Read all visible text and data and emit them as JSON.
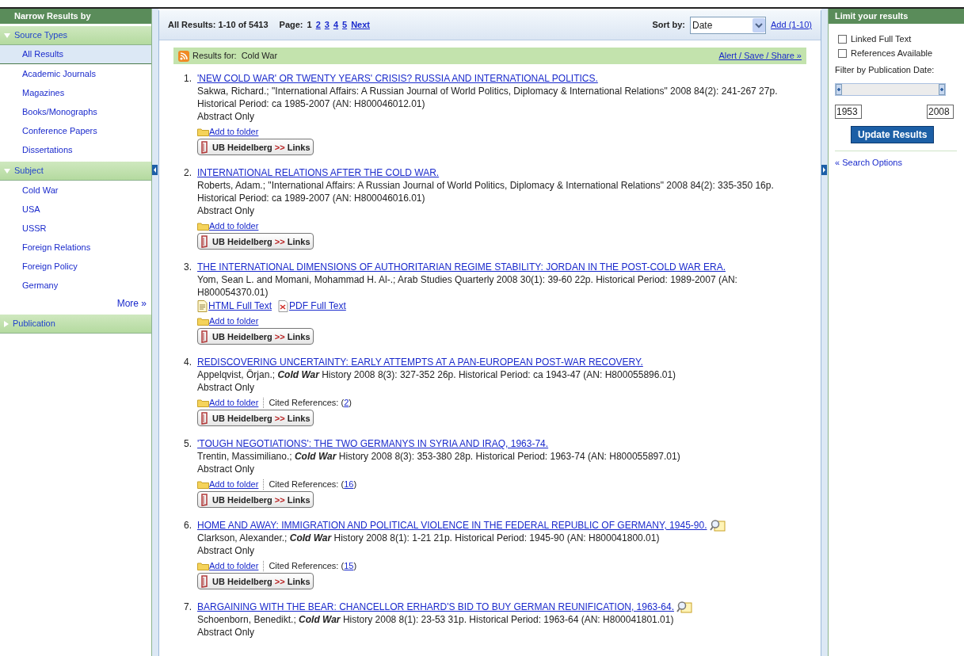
{
  "left_panel": {
    "title": "Narrow Results by",
    "sections": [
      {
        "label": "Source Types",
        "expanded": true,
        "items": [
          {
            "label": "All Results",
            "selected": true
          },
          {
            "label": "Academic Journals",
            "selected": false
          },
          {
            "label": "Magazines",
            "selected": false
          },
          {
            "label": "Books/Monographs",
            "selected": false
          },
          {
            "label": "Conference Papers",
            "selected": false
          },
          {
            "label": "Dissertations",
            "selected": false
          }
        ]
      },
      {
        "label": "Subject",
        "expanded": true,
        "items": [
          {
            "label": "Cold War",
            "selected": false
          },
          {
            "label": "USA",
            "selected": false
          },
          {
            "label": "USSR",
            "selected": false
          },
          {
            "label": "Foreign Relations",
            "selected": false
          },
          {
            "label": "Foreign Policy",
            "selected": false
          },
          {
            "label": "Germany",
            "selected": false
          }
        ],
        "more": "More »"
      },
      {
        "label": "Publication",
        "expanded": false
      }
    ]
  },
  "results_header": {
    "summary": "All Results: 1-10 of 5413",
    "page_label": "Page:",
    "pages": [
      {
        "label": "1",
        "selected": true
      },
      {
        "label": "2",
        "selected": false
      },
      {
        "label": "3",
        "selected": false
      },
      {
        "label": "4",
        "selected": false
      },
      {
        "label": "5",
        "selected": false
      }
    ],
    "next": "Next",
    "sort_label": "Sort by:",
    "sort_value": "Date",
    "add_link": "Add (1-10)"
  },
  "results_for": {
    "label": "Results for:",
    "query": "Cold War",
    "share_link": "Alert / Save / Share »"
  },
  "results": [
    {
      "number": "1.",
      "title": "'NEW COLD WAR' OR TWENTY YEARS' CRISIS? RUSSIA AND INTERNATIONAL POLITICS.",
      "preview": false,
      "citation": "Sakwa, Richard.; \"International Affairs: A Russian Journal of World Politics, Diplomacy & International Relations\" 2008 84(2): 241-267 27p. Historical Period: ca 1985-2007 (AN: H800046012.01)",
      "availability": "Abstract Only",
      "folder": "Add to folder",
      "link_button": {
        "name": "UB Heidelberg",
        "arrows": ">>",
        "label": "Links"
      }
    },
    {
      "number": "2.",
      "title": "INTERNATIONAL RELATIONS AFTER THE COLD WAR.",
      "preview": false,
      "citation": "Roberts, Adam.; \"International Affairs: A Russian Journal of World Politics, Diplomacy & International Relations\" 2008 84(2): 335-350 16p. Historical Period: ca 1989-2007 (AN: H800046016.01)",
      "availability": "Abstract Only",
      "folder": "Add to folder",
      "link_button": {
        "name": "UB Heidelberg",
        "arrows": ">>",
        "label": "Links"
      }
    },
    {
      "number": "3.",
      "title": "THE INTERNATIONAL DIMENSIONS OF AUTHORITARIAN REGIME STABILITY: JORDAN IN THE POST-COLD WAR ERA.",
      "preview": false,
      "citation": "Yom, Sean L. and Momani, Mohammad H. Al-.; Arab Studies Quarterly 2008 30(1): 39-60 22p. Historical Period: 1989-2007 (AN: H800054370.01)",
      "full_text": [
        {
          "kind": "html",
          "label": "HTML Full Text"
        },
        {
          "kind": "pdf",
          "label": "PDF Full Text"
        }
      ],
      "folder": "Add to folder",
      "link_button": {
        "name": "UB Heidelberg",
        "arrows": ">>",
        "label": "Links"
      }
    },
    {
      "number": "4.",
      "title": "REDISCOVERING UNCERTAINTY: EARLY ATTEMPTS AT A PAN-EUROPEAN POST-WAR RECOVERY.",
      "preview": false,
      "citation": "Appelqvist, Örjan.; **Cold War** History 2008 8(3): 327-352 26p. Historical Period: ca 1943-47 (AN: H800055896.01)",
      "availability": "Abstract Only",
      "folder": "Add to folder",
      "cited_label": "Cited References: (",
      "cited_count": "2",
      "cited_end": ")",
      "link_button": {
        "name": "UB Heidelberg",
        "arrows": ">>",
        "label": "Links"
      }
    },
    {
      "number": "5.",
      "title": "'TOUGH NEGOTIATIONS': THE TWO GERMANYS IN SYRIA AND IRAQ, 1963-74.",
      "preview": false,
      "citation": "Trentin, Massimiliano.; **Cold War** History 2008 8(3): 353-380 28p. Historical Period: 1963-74 (AN: H800055897.01)",
      "availability": "Abstract Only",
      "folder": "Add to folder",
      "cited_label": "Cited References: (",
      "cited_count": "16",
      "cited_end": ")",
      "link_button": {
        "name": "UB Heidelberg",
        "arrows": ">>",
        "label": "Links"
      }
    },
    {
      "number": "6.",
      "title": "HOME AND AWAY: IMMIGRATION AND POLITICAL VIOLENCE IN THE FEDERAL REPUBLIC OF GERMANY, 1945-90.",
      "preview": true,
      "citation": "Clarkson, Alexander.; **Cold War** History 2008 8(1): 1-21 21p. Historical Period: 1945-90 (AN: H800041800.01)",
      "availability": "Abstract Only",
      "folder": "Add to folder",
      "cited_label": "Cited References: (",
      "cited_count": "15",
      "cited_end": ")",
      "link_button": {
        "name": "UB Heidelberg",
        "arrows": ">>",
        "label": "Links"
      }
    },
    {
      "number": "7.",
      "title": "BARGAINING WITH THE BEAR: CHANCELLOR ERHARD'S BID TO BUY GERMAN REUNIFICATION, 1963-64.",
      "preview": true,
      "citation": "Schoenborn, Benedikt.; **Cold War** History 2008 8(1): 23-53 31p. Historical Period: 1963-64 (AN: H800041801.01)",
      "availability": "Abstract Only"
    }
  ],
  "right_panel": {
    "title": "Limit your results",
    "checkboxes": [
      {
        "label": "Linked Full Text",
        "checked": false
      },
      {
        "label": "References Available",
        "checked": false
      }
    ],
    "filter_label": "Filter by Publication Date:",
    "thumbs": [
      {
        "level": 0
      },
      {
        "level": 1
      }
    ],
    "from": "1953",
    "to": "2008",
    "button": "Update Results",
    "search_options": "« Search Options"
  }
}
